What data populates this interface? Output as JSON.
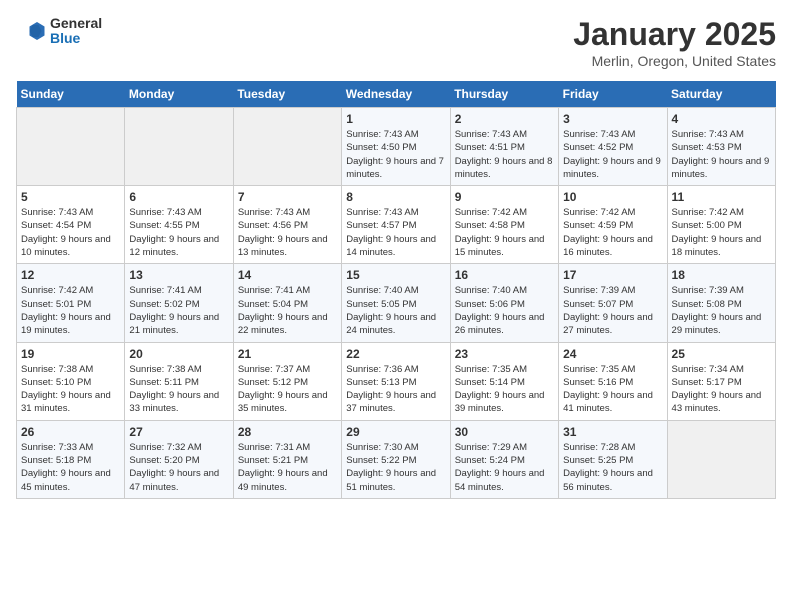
{
  "logo": {
    "general": "General",
    "blue": "Blue"
  },
  "title": "January 2025",
  "subtitle": "Merlin, Oregon, United States",
  "days_of_week": [
    "Sunday",
    "Monday",
    "Tuesday",
    "Wednesday",
    "Thursday",
    "Friday",
    "Saturday"
  ],
  "weeks": [
    [
      {
        "day": "",
        "info": ""
      },
      {
        "day": "",
        "info": ""
      },
      {
        "day": "",
        "info": ""
      },
      {
        "day": "1",
        "info": "Sunrise: 7:43 AM\nSunset: 4:50 PM\nDaylight: 9 hours and 7 minutes."
      },
      {
        "day": "2",
        "info": "Sunrise: 7:43 AM\nSunset: 4:51 PM\nDaylight: 9 hours and 8 minutes."
      },
      {
        "day": "3",
        "info": "Sunrise: 7:43 AM\nSunset: 4:52 PM\nDaylight: 9 hours and 9 minutes."
      },
      {
        "day": "4",
        "info": "Sunrise: 7:43 AM\nSunset: 4:53 PM\nDaylight: 9 hours and 9 minutes."
      }
    ],
    [
      {
        "day": "5",
        "info": "Sunrise: 7:43 AM\nSunset: 4:54 PM\nDaylight: 9 hours and 10 minutes."
      },
      {
        "day": "6",
        "info": "Sunrise: 7:43 AM\nSunset: 4:55 PM\nDaylight: 9 hours and 12 minutes."
      },
      {
        "day": "7",
        "info": "Sunrise: 7:43 AM\nSunset: 4:56 PM\nDaylight: 9 hours and 13 minutes."
      },
      {
        "day": "8",
        "info": "Sunrise: 7:43 AM\nSunset: 4:57 PM\nDaylight: 9 hours and 14 minutes."
      },
      {
        "day": "9",
        "info": "Sunrise: 7:42 AM\nSunset: 4:58 PM\nDaylight: 9 hours and 15 minutes."
      },
      {
        "day": "10",
        "info": "Sunrise: 7:42 AM\nSunset: 4:59 PM\nDaylight: 9 hours and 16 minutes."
      },
      {
        "day": "11",
        "info": "Sunrise: 7:42 AM\nSunset: 5:00 PM\nDaylight: 9 hours and 18 minutes."
      }
    ],
    [
      {
        "day": "12",
        "info": "Sunrise: 7:42 AM\nSunset: 5:01 PM\nDaylight: 9 hours and 19 minutes."
      },
      {
        "day": "13",
        "info": "Sunrise: 7:41 AM\nSunset: 5:02 PM\nDaylight: 9 hours and 21 minutes."
      },
      {
        "day": "14",
        "info": "Sunrise: 7:41 AM\nSunset: 5:04 PM\nDaylight: 9 hours and 22 minutes."
      },
      {
        "day": "15",
        "info": "Sunrise: 7:40 AM\nSunset: 5:05 PM\nDaylight: 9 hours and 24 minutes."
      },
      {
        "day": "16",
        "info": "Sunrise: 7:40 AM\nSunset: 5:06 PM\nDaylight: 9 hours and 26 minutes."
      },
      {
        "day": "17",
        "info": "Sunrise: 7:39 AM\nSunset: 5:07 PM\nDaylight: 9 hours and 27 minutes."
      },
      {
        "day": "18",
        "info": "Sunrise: 7:39 AM\nSunset: 5:08 PM\nDaylight: 9 hours and 29 minutes."
      }
    ],
    [
      {
        "day": "19",
        "info": "Sunrise: 7:38 AM\nSunset: 5:10 PM\nDaylight: 9 hours and 31 minutes."
      },
      {
        "day": "20",
        "info": "Sunrise: 7:38 AM\nSunset: 5:11 PM\nDaylight: 9 hours and 33 minutes."
      },
      {
        "day": "21",
        "info": "Sunrise: 7:37 AM\nSunset: 5:12 PM\nDaylight: 9 hours and 35 minutes."
      },
      {
        "day": "22",
        "info": "Sunrise: 7:36 AM\nSunset: 5:13 PM\nDaylight: 9 hours and 37 minutes."
      },
      {
        "day": "23",
        "info": "Sunrise: 7:35 AM\nSunset: 5:14 PM\nDaylight: 9 hours and 39 minutes."
      },
      {
        "day": "24",
        "info": "Sunrise: 7:35 AM\nSunset: 5:16 PM\nDaylight: 9 hours and 41 minutes."
      },
      {
        "day": "25",
        "info": "Sunrise: 7:34 AM\nSunset: 5:17 PM\nDaylight: 9 hours and 43 minutes."
      }
    ],
    [
      {
        "day": "26",
        "info": "Sunrise: 7:33 AM\nSunset: 5:18 PM\nDaylight: 9 hours and 45 minutes."
      },
      {
        "day": "27",
        "info": "Sunrise: 7:32 AM\nSunset: 5:20 PM\nDaylight: 9 hours and 47 minutes."
      },
      {
        "day": "28",
        "info": "Sunrise: 7:31 AM\nSunset: 5:21 PM\nDaylight: 9 hours and 49 minutes."
      },
      {
        "day": "29",
        "info": "Sunrise: 7:30 AM\nSunset: 5:22 PM\nDaylight: 9 hours and 51 minutes."
      },
      {
        "day": "30",
        "info": "Sunrise: 7:29 AM\nSunset: 5:24 PM\nDaylight: 9 hours and 54 minutes."
      },
      {
        "day": "31",
        "info": "Sunrise: 7:28 AM\nSunset: 5:25 PM\nDaylight: 9 hours and 56 minutes."
      },
      {
        "day": "",
        "info": ""
      }
    ]
  ]
}
